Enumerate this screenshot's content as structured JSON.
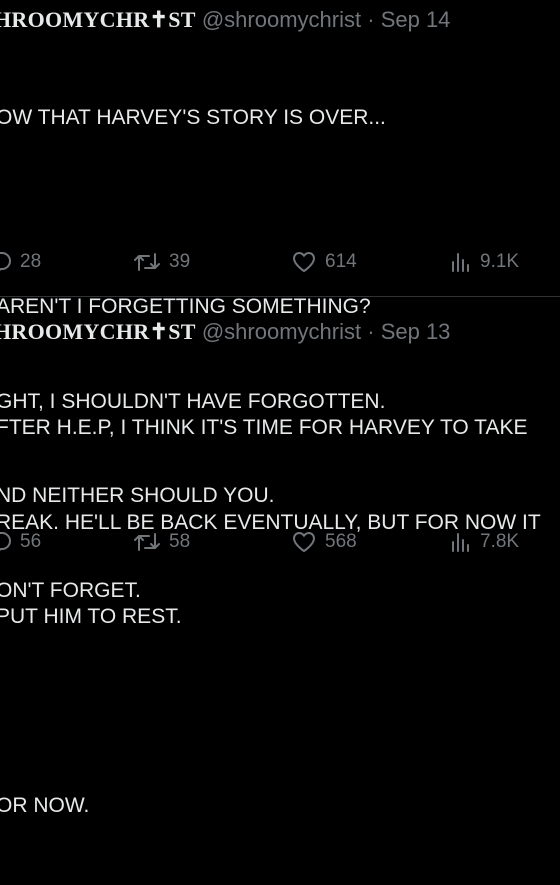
{
  "tweets": [
    {
      "display_name": "HROOMYCHR✝ST",
      "handle": "@shroomychrist",
      "separator": "·",
      "date": "Sep 14",
      "lines": [
        "OW THAT HARVEY'S STORY IS OVER...",
        "",
        "AREN'T I FORGETTING SOMETHING?",
        "GHT, I SHOULDN'T HAVE FORGOTTEN.",
        "ND NEITHER SHOULD YOU.",
        "ON'T FORGET."
      ],
      "replies": "28",
      "retweets": "39",
      "likes": "614",
      "views": "9.1K"
    },
    {
      "display_name": "HROOMYCHR✝ST",
      "handle": "@shroomychrist",
      "separator": "·",
      "date": "Sep 13",
      "lines": [
        "FTER H.E.P, I THINK IT'S TIME FOR HARVEY TO TAKE",
        "REAK. HE'LL BE BACK EVENTUALLY, BUT FOR NOW IT",
        "PUT HIM TO REST.",
        "",
        "OR NOW."
      ],
      "replies": "56",
      "retweets": "58",
      "likes": "568",
      "views": "7.8K"
    }
  ],
  "icons": {
    "reply": "reply-icon",
    "retweet": "retweet-icon",
    "like": "heart-icon",
    "views": "views-icon"
  },
  "colors": {
    "background": "#000000",
    "text": "#e7e9ea",
    "muted": "#71767b",
    "divider": "#2f3336"
  }
}
